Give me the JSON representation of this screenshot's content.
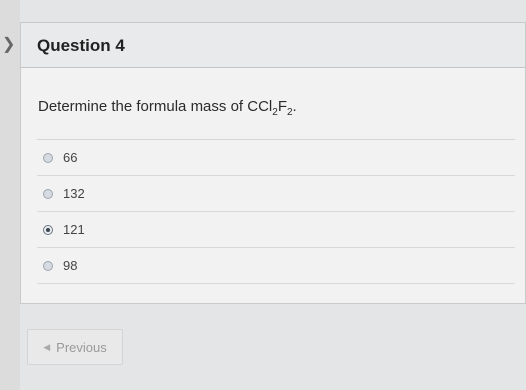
{
  "question": {
    "title": "Question 4",
    "prompt_prefix": "Determine the formula mass of CCl",
    "sub1": "2",
    "mid": "F",
    "sub2": "2",
    "suffix": "."
  },
  "answers": [
    {
      "label": "66",
      "selected": false
    },
    {
      "label": "132",
      "selected": false
    },
    {
      "label": "121",
      "selected": true
    },
    {
      "label": "98",
      "selected": false
    }
  ],
  "navigation": {
    "previous_label": "Previous",
    "previous_icon": "triangle-left-icon",
    "side_icon": "chevron-right-icon"
  }
}
